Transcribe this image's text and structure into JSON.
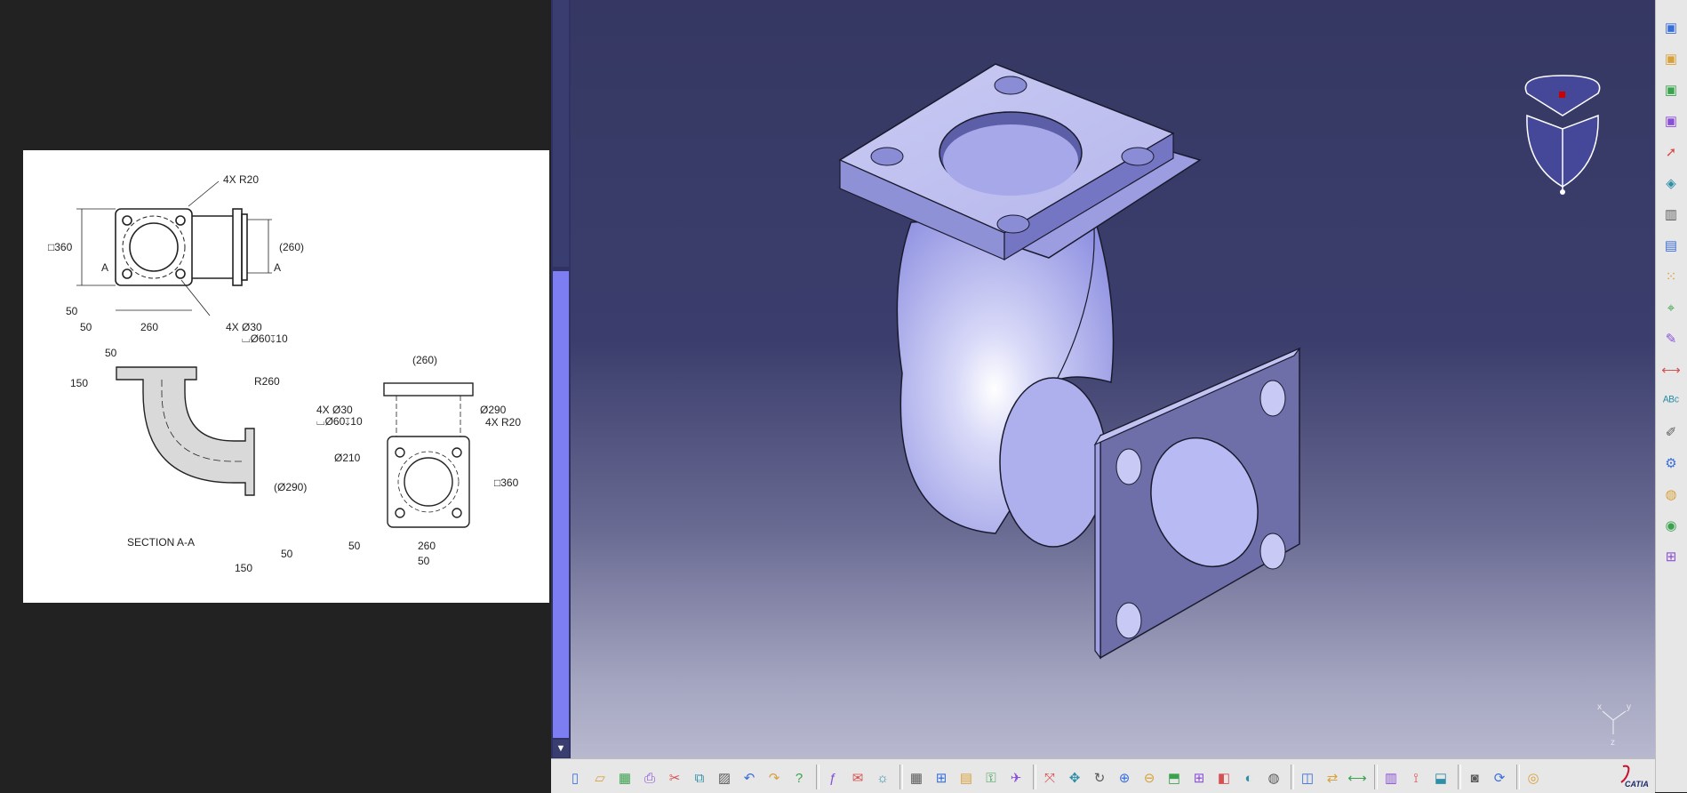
{
  "drawing": {
    "callouts": {
      "top_radius": "4X R20",
      "top_square": "□360",
      "top_width": "(260)",
      "top_hole_a": "A",
      "top_hole_b": "A",
      "top_offset_v": "50",
      "top_offset_h": "50",
      "top_span": "260",
      "top_holes": "4X Ø30",
      "top_cbore": "⌴Ø60↧10",
      "sec_flange": "50",
      "sec_height": "150",
      "sec_radius": "R260",
      "sec_dia": "(Ø290)",
      "sec_label": "SECTION A-A",
      "sec_bottom_150": "150",
      "sec_bottom_50": "50",
      "side_width": "(260)",
      "side_holes": "4X Ø30",
      "side_cbore": "⌴Ø60↧10",
      "side_dia290": "Ø290",
      "side_radius": "4X R20",
      "side_dia210": "Ø210",
      "side_square": "□360",
      "side_offset_v": "50",
      "side_span": "260",
      "side_offset_h": "50"
    }
  },
  "viewer": {
    "background_top": "#363863",
    "background_bottom": "#b8b9cf",
    "scroll_thumb": "#7c7ef2",
    "compass_pole": "#cc0000",
    "axis_labels": {
      "x": "x",
      "y": "y",
      "z": "z"
    }
  },
  "right_toolbar": {
    "icons": [
      "part-body-icon",
      "part-body-icon",
      "part-body-icon",
      "part-body-icon",
      "select-arrow-icon",
      "surface-icon",
      "pad-icon",
      "pocket-icon",
      "pattern-icon",
      "constraint-icon",
      "sketch-icon",
      "measure-icon",
      "text-abc-icon",
      "annotation-icon",
      "knowledge-icon",
      "globe-icon",
      "analysis-icon",
      "tree-icon"
    ]
  },
  "bottom_toolbar": {
    "icons": [
      "new-icon",
      "open-icon",
      "save-icon",
      "print-icon",
      "cut-icon",
      "copy-icon",
      "paste-icon",
      "undo-icon",
      "redo-icon",
      "help-icon",
      "formula-icon",
      "comment-icon",
      "light-icon",
      "table-icon",
      "tree-icon",
      "catalog-icon",
      "param-icon",
      "fly-icon",
      "fit-all-icon",
      "pan-icon",
      "rotate-icon",
      "zoom-in-icon",
      "zoom-out-icon",
      "normal-view-icon",
      "multi-view-icon",
      "iso-view-icon",
      "shading-icon",
      "render-icon",
      "hide-icon",
      "swap-icon",
      "measure-icon",
      "catalog-browser-icon",
      "thread-icon",
      "apply-material-icon",
      "capture-icon",
      "animate-icon",
      "web-icon"
    ],
    "brand": "CATIA"
  }
}
